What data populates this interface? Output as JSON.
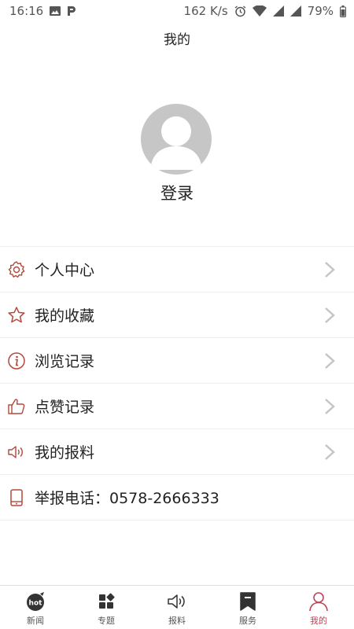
{
  "status_bar": {
    "time": "16:16",
    "network_speed": "162 K/s",
    "battery": "79%"
  },
  "header": {
    "title": "我的"
  },
  "profile": {
    "login_label": "登录"
  },
  "menu": {
    "items": [
      {
        "label": "个人中心",
        "icon": "gear-icon"
      },
      {
        "label": "我的收藏",
        "icon": "star-icon"
      },
      {
        "label": "浏览记录",
        "icon": "info-icon"
      },
      {
        "label": "点赞记录",
        "icon": "thumbs-up-icon"
      },
      {
        "label": "我的报料",
        "icon": "speaker-icon"
      }
    ],
    "hotline": {
      "label": "举报电话：0578-2666333",
      "icon": "phone-icon"
    }
  },
  "bottom_nav": {
    "items": [
      {
        "label": "新闻",
        "icon": "hot-icon"
      },
      {
        "label": "专题",
        "icon": "grid-icon"
      },
      {
        "label": "报料",
        "icon": "speaker-icon"
      },
      {
        "label": "服务",
        "icon": "bookmark-icon"
      },
      {
        "label": "我的",
        "icon": "person-icon"
      }
    ],
    "active_index": 4
  },
  "colors": {
    "accent": "#c0435a",
    "icon_red": "#b5483a",
    "chevron": "#c4c4c4",
    "avatar": "#c6c6c6"
  }
}
